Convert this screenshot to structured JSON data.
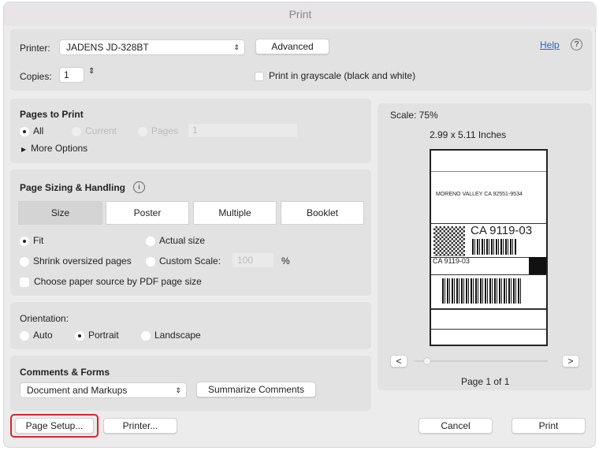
{
  "window": {
    "title": "Print"
  },
  "printer": {
    "label": "Printer:",
    "value": "JADENS JD-328BT",
    "advanced": "Advanced",
    "help": "Help",
    "help_icon": "?"
  },
  "copies": {
    "label": "Copies:",
    "value": "1",
    "grayscale": "Print in grayscale (black and white)",
    "grayscale_checked": false
  },
  "pages": {
    "title": "Pages to Print",
    "all": "All",
    "current": "Current",
    "pages": "Pages",
    "pages_value": "1",
    "more": "More Options",
    "selected": "All"
  },
  "sizing": {
    "title": "Page Sizing & Handling",
    "tabs": [
      "Size",
      "Poster",
      "Multiple",
      "Booklet"
    ],
    "active_tab": "Size",
    "fit": "Fit",
    "actual": "Actual size",
    "shrink": "Shrink oversized pages",
    "custom": "Custom Scale:",
    "custom_value": "100",
    "percent": "%",
    "paper_source": "Choose paper source by PDF page size",
    "selected": "Fit"
  },
  "orientation": {
    "title": "Orientation:",
    "auto": "Auto",
    "portrait": "Portrait",
    "landscape": "Landscape",
    "selected": "Portrait"
  },
  "comments": {
    "title": "Comments & Forms",
    "value": "Document and Markups",
    "summarize": "Summarize Comments"
  },
  "preview": {
    "scale": "Scale: 75%",
    "size": "2.99 x 5.11 Inches",
    "page": "Page 1 of 1",
    "prev": "<",
    "next": ">",
    "label_code": "CA 9119-03",
    "label_code2": "CA 9119-03",
    "label_address": "MORENO VALLEY CA 92551-9534"
  },
  "footer": {
    "page_setup": "Page Setup...",
    "printer": "Printer...",
    "cancel": "Cancel",
    "print": "Print"
  },
  "colors": {
    "highlight": "#d9262c"
  }
}
